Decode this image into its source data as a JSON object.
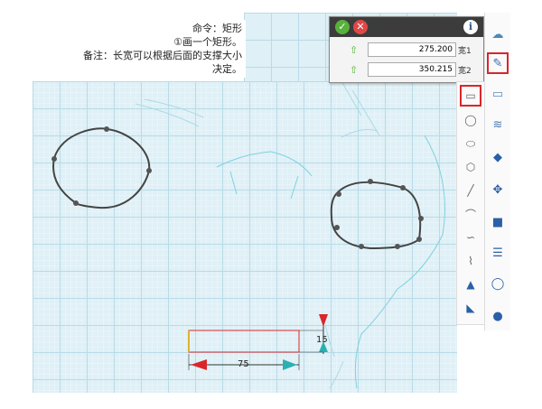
{
  "command_text": {
    "line1": "命令：矩形",
    "line2": "①画一个矩形。",
    "line3": "备注：长宽可以根据后面的支撑大小",
    "line4": "决定。"
  },
  "panel": {
    "ok_icon": "check-icon",
    "cancel_icon": "close-icon",
    "info_icon": "info-icon",
    "param1": {
      "value": "275.200",
      "label": "宽1"
    },
    "param2": {
      "value": "350.215",
      "label": "宽2"
    }
  },
  "dimensions": {
    "width_label": "75",
    "height_label": "15"
  },
  "sidebar": {
    "items": [
      {
        "icon": "cloud-icon"
      },
      {
        "icon": "sketch-pen-icon",
        "selected": true
      },
      {
        "icon": "page-icon"
      },
      {
        "icon": "layers-icon"
      },
      {
        "icon": "cube-icon"
      },
      {
        "icon": "move-icon"
      },
      {
        "icon": "box-icon"
      },
      {
        "icon": "panel-icon"
      },
      {
        "icon": "circle-icon"
      },
      {
        "icon": "sphere-icon"
      }
    ]
  },
  "subbar": {
    "items": [
      {
        "icon": "rectangle-icon",
        "selected": true
      },
      {
        "icon": "circle-icon"
      },
      {
        "icon": "ellipse-icon"
      },
      {
        "icon": "polygon-icon"
      },
      {
        "icon": "line-icon"
      },
      {
        "icon": "arc-icon"
      },
      {
        "icon": "curve-icon"
      },
      {
        "icon": "polyline-icon"
      },
      {
        "icon": "triangle-icon"
      },
      {
        "icon": "text-icon"
      }
    ]
  },
  "colors": {
    "accent_red": "#d9262b",
    "ok_green": "#58b13a",
    "grid": "#b8dbe8",
    "sketch_line": "#444444"
  }
}
